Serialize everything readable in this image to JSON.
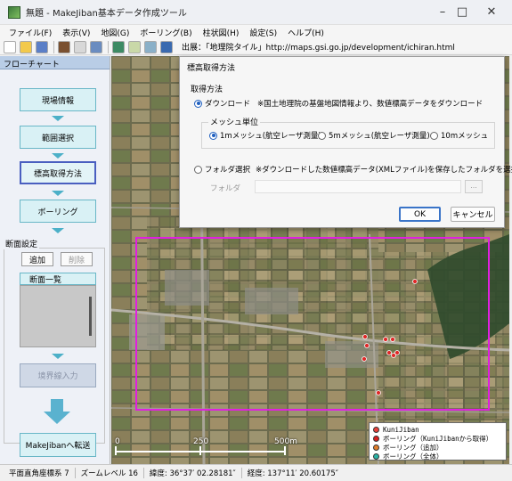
{
  "window": {
    "title": "無題 - MakeJiban基本データ作成ツール"
  },
  "menu": [
    "ファイル(F)",
    "表示(V)",
    "地図(G)",
    "ボーリング(B)",
    "柱状図(H)",
    "設定(S)",
    "ヘルプ(H)"
  ],
  "toolbar": {
    "source_text": "出展：「地理院タイル」http://maps.gsi.go.jp/development/ichiran.html"
  },
  "flowchart": {
    "header": "フローチャート",
    "steps": [
      "現場情報",
      "範囲選択",
      "標高取得方法",
      "ボーリング"
    ],
    "section_label": "断面設定",
    "add_label": "追加",
    "delete_label": "削除",
    "list_title": "断面一覧",
    "cross_section_input": "境界線入力",
    "transfer_label": "MakeJibanへ転送"
  },
  "dialog": {
    "title": "標高取得方法",
    "group_label": "取得方法",
    "download_label": "ダウンロード",
    "download_note": "※国土地理院の基盤地図情報より、数値標高データをダウンロード",
    "mesh_label": "メッシュ単位",
    "mesh_options": [
      "1mメッシュ(航空レーザ測量)",
      "5mメッシュ(航空レーザ測量)",
      "10mメッシュ"
    ],
    "mesh_selected": "1mメッシュ(航空レーザ測量)",
    "folder_select_label": "フォルダ選択",
    "folder_note": "※ダウンロードした数値標高データ(XMLファイル)を保存したフォルダを選択",
    "folder_label": "フォルダ",
    "folder_value": "",
    "browse_label": "...",
    "ok_label": "OK",
    "cancel_label": "キャンセル"
  },
  "legend": [
    {
      "label": "KuniJiban",
      "color": "#e8403a"
    },
    {
      "label": "ボーリング（KuniJibanから取得）",
      "color": "#d81e1e"
    },
    {
      "label": "ボーリング（追加）",
      "color": "#e07d2a"
    },
    {
      "label": "ボーリング（全体）",
      "color": "#2ab3a6"
    }
  ],
  "scale": {
    "zero": "0",
    "mid": "250",
    "end": "500m"
  },
  "status": {
    "coord_system": "平面直角座標系 7",
    "zoom": "ズームレベル 16",
    "lat": "緯度: 36°37′ 02.28181″",
    "lon": "経度: 137°11′ 20.60175″"
  },
  "colors": {
    "selection": "#e020e0",
    "accent": "#3a74c8"
  }
}
